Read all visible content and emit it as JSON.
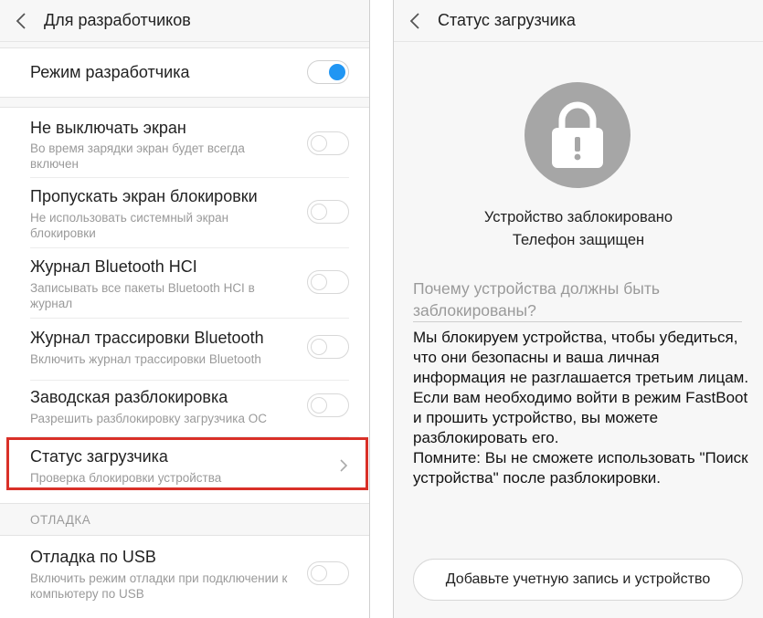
{
  "left": {
    "header": {
      "title": "Для разработчиков",
      "back_icon": "back-chevron-icon"
    },
    "developer_mode": {
      "title": "Режим разработчика",
      "enabled": true
    },
    "items": [
      {
        "title": "Не выключать экран",
        "subtitle": "Во время зарядки экран будет всегда включен",
        "enabled": false
      },
      {
        "title": "Пропускать экран блокировки",
        "subtitle": "Не использовать системный экран блокировки",
        "enabled": false
      },
      {
        "title": "Журнал Bluetooth HCI",
        "subtitle": "Записывать все пакеты Bluetooth HCI в журнал",
        "enabled": false
      },
      {
        "title": "Журнал трассировки Bluetooth",
        "subtitle": "Включить журнал трассировки Bluetooth",
        "enabled": false
      },
      {
        "title": "Заводская разблокировка",
        "subtitle": "Разрешить разблокировку загрузчика ОС",
        "enabled": false
      },
      {
        "title": "Статус загрузчика",
        "subtitle": "Проверка блокировки устройства",
        "chevron_icon": "chevron-right-icon",
        "highlight_color": "#d93028"
      }
    ],
    "debug_section": {
      "label": "ОТЛАДКА",
      "items": [
        {
          "title": "Отладка по USB",
          "subtitle": "Включить режим отладки при подключении к компьютеру по USB",
          "enabled": false
        }
      ]
    }
  },
  "right": {
    "header": {
      "title": "Статус загрузчика",
      "back_icon": "back-chevron-icon"
    },
    "lock_icon": "padlock-icon",
    "status_line1": "Устройство заблокировано",
    "status_line2": "Телефон защищен",
    "question": "Почему устройства должны быть заблокированы?",
    "body_paragraph1": "Мы блокируем устройства, чтобы убедиться, что они безопасны и ваша личная информация не разглашается третьим лицам. Если вам необходимо войти в режим FastBoot и прошить устройство, вы можете разблокировать его.",
    "body_paragraph2": "Помните: Вы не сможете использовать \"Поиск устройства\" после разблокировки.",
    "button_label": "Добавьте учетную запись и устройство"
  },
  "colors": {
    "accent_toggle": "#2196f3",
    "highlight": "#d93028",
    "lock_circle": "#a6a6a6"
  }
}
